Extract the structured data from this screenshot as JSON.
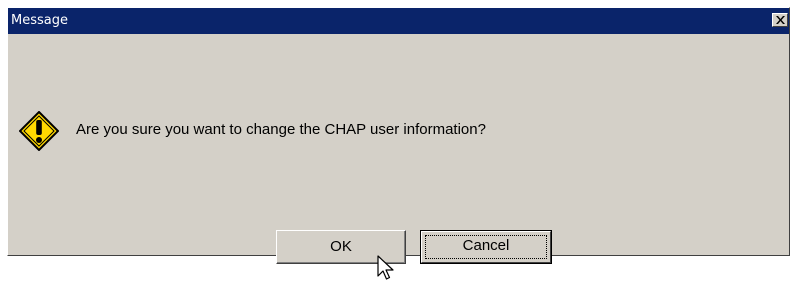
{
  "dialog": {
    "title": "Message",
    "message": "Are you sure you want to change the CHAP user information?",
    "icon": "warning-exclamation-icon",
    "buttons": {
      "ok": "OK",
      "cancel": "Cancel"
    },
    "focused_button": "cancel"
  },
  "colors": {
    "titlebar": "#0a246a",
    "title_text": "#ffffff",
    "window_bg": "#d4d0c8",
    "icon_fill": "#ffd800"
  }
}
